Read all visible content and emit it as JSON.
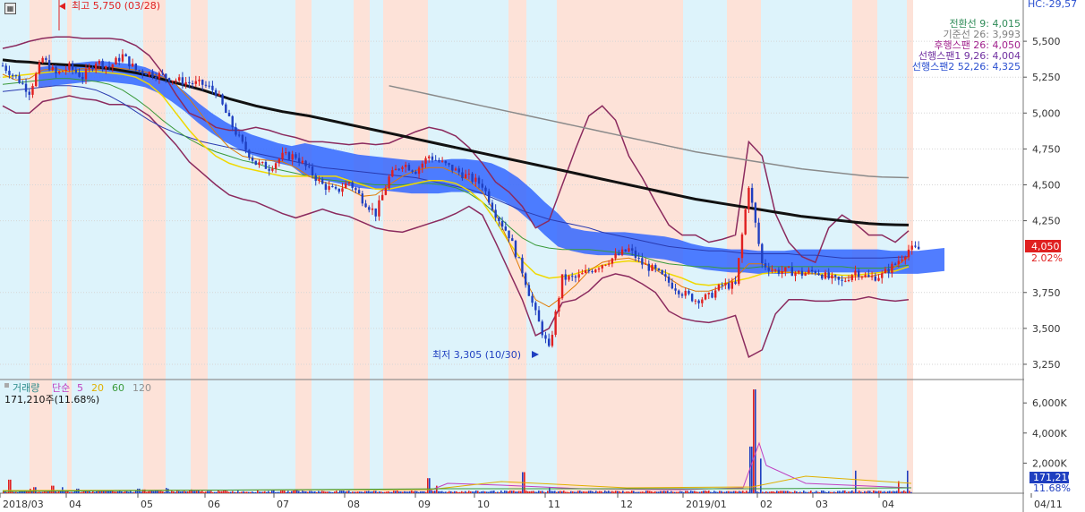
{
  "chart_data": {
    "type": "candlestick",
    "price_axis": {
      "ticks": [
        5500,
        5250,
        5000,
        4750,
        4500,
        4250,
        3750,
        3500,
        3250
      ],
      "ylim": [
        3150,
        5750
      ]
    },
    "volume_axis": {
      "ticks": [
        "6,000K",
        "4,000K",
        "2,000K"
      ],
      "ylim": [
        0,
        7200
      ]
    },
    "time_axis": {
      "labels": [
        "2018/03",
        "04",
        "05",
        "06",
        "07",
        "08",
        "09",
        "10",
        "11",
        "12",
        "2019/01",
        "02",
        "03",
        "04",
        "04/11"
      ]
    },
    "legend_price": [
      {
        "label": "전환선 9: 4,015",
        "color": "#2e8b57"
      },
      {
        "label": "기준선 26: 3,993",
        "color": "#808080"
      },
      {
        "label": "후행스팬 26: 4,050",
        "color": "#a0208c"
      },
      {
        "label": "선행스팬1 9,26: 4,004",
        "color": "#7030a0"
      },
      {
        "label": "선행스팬2 52,26: 4,325",
        "color": "#2a4fd0"
      }
    ],
    "top_right_label": "HC:-29,57",
    "annotations": {
      "high": "최고 5,750 (03/28)",
      "low": "최저 3,305 (10/30)"
    },
    "current_price": {
      "value": "4,050",
      "change": "2.02%"
    },
    "volume_legend": {
      "title": "거래량",
      "items": [
        {
          "label": "단순",
          "color": "#c040c0"
        },
        {
          "label": "5",
          "color": "#c040c0"
        },
        {
          "label": "20",
          "color": "#e0b000"
        },
        {
          "label": "60",
          "color": "#3a9a3a"
        },
        {
          "label": "120",
          "color": "#909090"
        }
      ],
      "volume_text": "171,210주(11.68%)"
    },
    "current_volume": {
      "value": "171,210",
      "pct": "11.68%"
    },
    "price_series": {
      "close_path": [
        5330,
        5250,
        5150,
        5380,
        5270,
        5320,
        5250,
        5360,
        5320,
        5400,
        5300,
        5280,
        5260,
        5230,
        5210,
        5200,
        5150,
        4950,
        4780,
        4650,
        4620,
        4700,
        4700,
        4600,
        4500,
        4450,
        4520,
        4400,
        4300,
        4550,
        4650,
        4600,
        4700,
        4650,
        4600,
        4550,
        4500,
        4300,
        4150,
        3900,
        3600,
        3350,
        3850,
        3850,
        3900,
        3950,
        4000,
        4050,
        3950,
        3900,
        3820,
        3750,
        3700,
        3720,
        3800,
        3800,
        4500,
        3950,
        3900,
        3900,
        3880,
        3900,
        3850,
        3820,
        3900,
        3850,
        3870,
        3950,
        4050
      ],
      "ma5": [
        5270,
        5230,
        5240,
        5300,
        5310,
        5290,
        5310,
        5300,
        5320,
        5310,
        5300,
        5280,
        5250,
        5200,
        5100,
        4980,
        4860,
        4760,
        4700,
        4680,
        4670,
        4660,
        4620,
        4560,
        4520,
        4500,
        4470,
        4420,
        4430,
        4500,
        4560,
        4600,
        4620,
        4620,
        4580,
        4530,
        4450,
        4300,
        4100,
        3880,
        3700,
        3650,
        3720,
        3800,
        3900,
        3960,
        3980,
        3990,
        3960,
        3910,
        3850,
        3790,
        3760,
        3760,
        3790,
        3850,
        3950,
        3950,
        3900,
        3890,
        3880,
        3880,
        3860,
        3850,
        3860,
        3860,
        3880,
        3930,
        4000
      ],
      "ma20": [
        5250,
        5260,
        5270,
        5280,
        5290,
        5290,
        5290,
        5290,
        5280,
        5270,
        5250,
        5200,
        5120,
        5000,
        4880,
        4780,
        4700,
        4650,
        4620,
        4600,
        4580,
        4560,
        4560,
        4560,
        4560,
        4560,
        4530,
        4500,
        4470,
        4470,
        4490,
        4510,
        4530,
        4530,
        4510,
        4460,
        4380,
        4250,
        4100,
        3970,
        3880,
        3850,
        3860,
        3880,
        3910,
        3940,
        3960,
        3970,
        3960,
        3920,
        3880,
        3850,
        3810,
        3800,
        3810,
        3830,
        3850,
        3880,
        3890,
        3890,
        3890,
        3880,
        3880,
        3870,
        3870,
        3880,
        3890,
        3900,
        3930
      ],
      "ma60": [
        5200,
        5210,
        5220,
        5230,
        5240,
        5240,
        5230,
        5220,
        5200,
        5160,
        5100,
        5030,
        4950,
        4880,
        4820,
        4770,
        4730,
        4700,
        4670,
        4650,
        4620,
        4600,
        4580,
        4560,
        4540,
        4530,
        4520,
        4510,
        4500,
        4500,
        4500,
        4510,
        4510,
        4500,
        4480,
        4440,
        4380,
        4300,
        4210,
        4130,
        4080,
        4060,
        4050,
        4050,
        4050,
        4040,
        4030,
        4020,
        4000,
        3970,
        3950,
        3940,
        3930,
        3930,
        3920,
        3920,
        3920,
        3930,
        3930,
        3930,
        3930,
        3930,
        3930,
        3930,
        3920,
        3920,
        3920,
        3930,
        3940
      ],
      "ma120": [
        5150,
        5160,
        5170,
        5180,
        5190,
        5190,
        5180,
        5160,
        5120,
        5070,
        5010,
        4950,
        4900,
        4860,
        4830,
        4800,
        4780,
        4760,
        4740,
        4720,
        4700,
        4680,
        4660,
        4640,
        4620,
        4610,
        4600,
        4590,
        4580,
        4570,
        4560,
        4550,
        4530,
        4510,
        4490,
        4470,
        4440,
        4400,
        4360,
        4320,
        4290,
        4260,
        4240,
        4220,
        4200,
        4170,
        4150,
        4130,
        4110,
        4090,
        4070,
        4060,
        4050,
        4040,
        4040,
        4030,
        4020,
        4020,
        4020,
        4020,
        4010,
        4010,
        4000,
        3990,
        3990,
        3990,
        3990,
        3995,
        4000
      ],
      "ma240": [
        5370,
        5360,
        5355,
        5345,
        5340,
        5335,
        5330,
        5320,
        5310,
        5295,
        5280,
        5260,
        5235,
        5210,
        5185,
        5160,
        5130,
        5100,
        5075,
        5050,
        5030,
        5010,
        4995,
        4980,
        4960,
        4940,
        4920,
        4900,
        4880,
        4860,
        4840,
        4820,
        4800,
        4780,
        4760,
        4740,
        4720,
        4700,
        4680,
        4660,
        4640,
        4620,
        4600,
        4580,
        4560,
        4540,
        4520,
        4500,
        4480,
        4460,
        4440,
        4420,
        4400,
        4385,
        4370,
        4355,
        4340,
        4325,
        4310,
        4295,
        4280,
        4270,
        4260,
        4250,
        4240,
        4230,
        4225,
        4222,
        4220
      ],
      "bb_upper": [
        5450,
        5470,
        5500,
        5520,
        5530,
        5530,
        5520,
        5520,
        5520,
        5510,
        5470,
        5400,
        5280,
        5130,
        5000,
        4960,
        4900,
        4880,
        4880,
        4900,
        4880,
        4850,
        4830,
        4800,
        4800,
        4790,
        4780,
        4790,
        4780,
        4790,
        4830,
        4870,
        4900,
        4880,
        4840,
        4760,
        4650,
        4520,
        4450,
        4350,
        4200,
        4250,
        4500,
        4750,
        4980,
        5050,
        4950,
        4700,
        4550,
        4380,
        4220,
        4150,
        4150,
        4100,
        4120,
        4150,
        4800,
        4700,
        4300,
        4100,
        4000,
        3960,
        4200,
        4290,
        4230,
        4150,
        4150,
        4100,
        4180
      ],
      "bb_lower": [
        5050,
        5000,
        5000,
        5080,
        5100,
        5120,
        5100,
        5090,
        5060,
        5060,
        5040,
        4980,
        4880,
        4780,
        4660,
        4580,
        4500,
        4430,
        4400,
        4380,
        4340,
        4300,
        4270,
        4300,
        4330,
        4300,
        4280,
        4240,
        4200,
        4180,
        4170,
        4200,
        4230,
        4260,
        4300,
        4350,
        4290,
        4100,
        3900,
        3700,
        3450,
        3500,
        3680,
        3700,
        3760,
        3850,
        3880,
        3860,
        3810,
        3750,
        3620,
        3570,
        3550,
        3540,
        3560,
        3590,
        3300,
        3350,
        3600,
        3700,
        3700,
        3690,
        3690,
        3700,
        3700,
        3720,
        3700,
        3690,
        3700
      ]
    }
  }
}
